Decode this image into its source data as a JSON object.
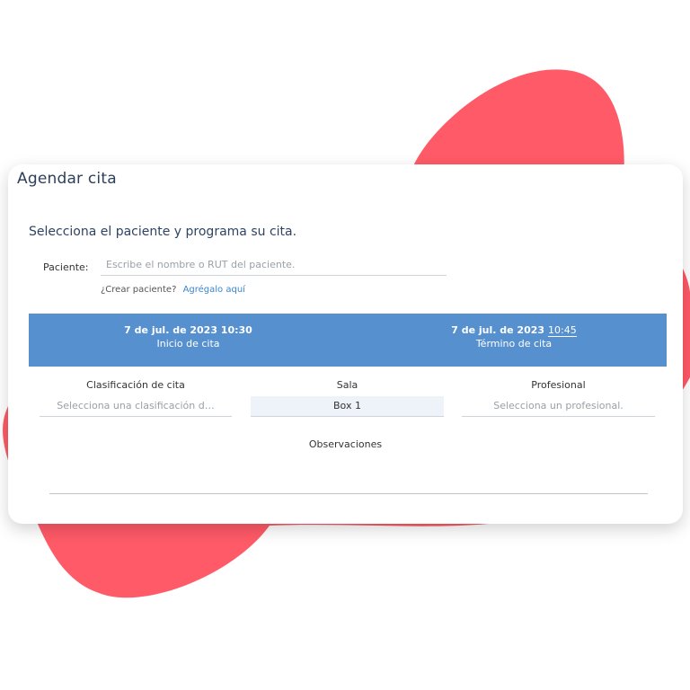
{
  "modal": {
    "title": "Agendar cita",
    "subtitle": "Selecciona el paciente y programa su cita."
  },
  "patient": {
    "label": "Paciente:",
    "placeholder": "Escribe el nombre o RUT del paciente.",
    "create_prompt": "¿Crear paciente?",
    "create_link": "Agrégalo aquí"
  },
  "schedule": {
    "start_date": "7 de jul. de 2023 10:30",
    "start_caption": "Inicio de cita",
    "end_date": "7 de jul. de 2023",
    "end_time": "10:45",
    "end_caption": "Término de cita"
  },
  "fields": {
    "clasificacion_label": "Clasificación de cita",
    "clasificacion_placeholder": "Selecciona una clasificación d…",
    "sala_label": "Sala",
    "sala_value": "Box 1",
    "profesional_label": "Profesional",
    "profesional_placeholder": "Selecciona un profesional."
  },
  "observaciones": {
    "label": "Observaciones"
  },
  "colors": {
    "accent_band": "#5690cf",
    "blob": "#ff5a67",
    "link": "#3a86d1"
  }
}
